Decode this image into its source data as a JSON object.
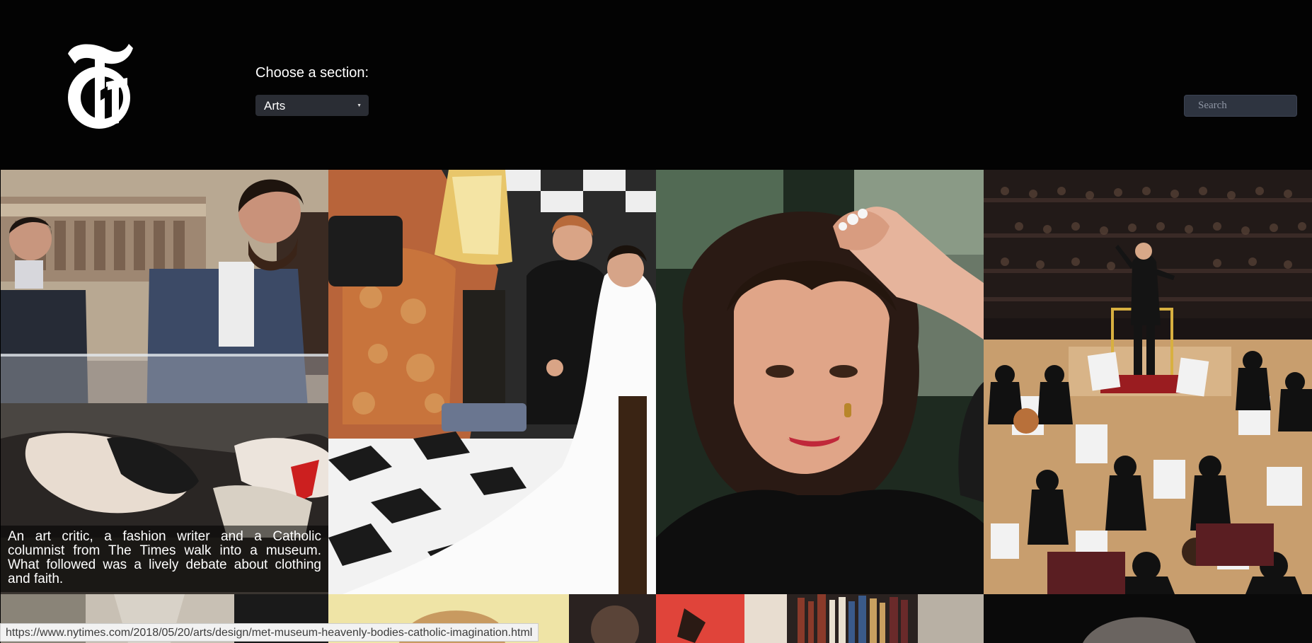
{
  "header": {
    "logo": "nyt-t-logo",
    "logo_text": "T",
    "section_label": "Choose a section:",
    "section_selected": "Arts",
    "search_placeholder": "Search"
  },
  "articles": [
    {
      "caption": "An art critic, a fashion writer and a Catholic columnist from The Times walk into a museum. What followed was a lively debate about clothing and faith."
    },
    {
      "caption": ""
    },
    {
      "caption": ""
    },
    {
      "caption": ""
    }
  ],
  "status_bar": {
    "url": "https://www.nytimes.com/2018/05/20/arts/design/met-museum-heavenly-bodies-catholic-imagination.html"
  },
  "icons": {
    "select_caret": "caret-down-icon"
  },
  "colors": {
    "header_bg": "#030303",
    "select_bg": "#2a2d34",
    "search_bg": "#2e3440"
  }
}
